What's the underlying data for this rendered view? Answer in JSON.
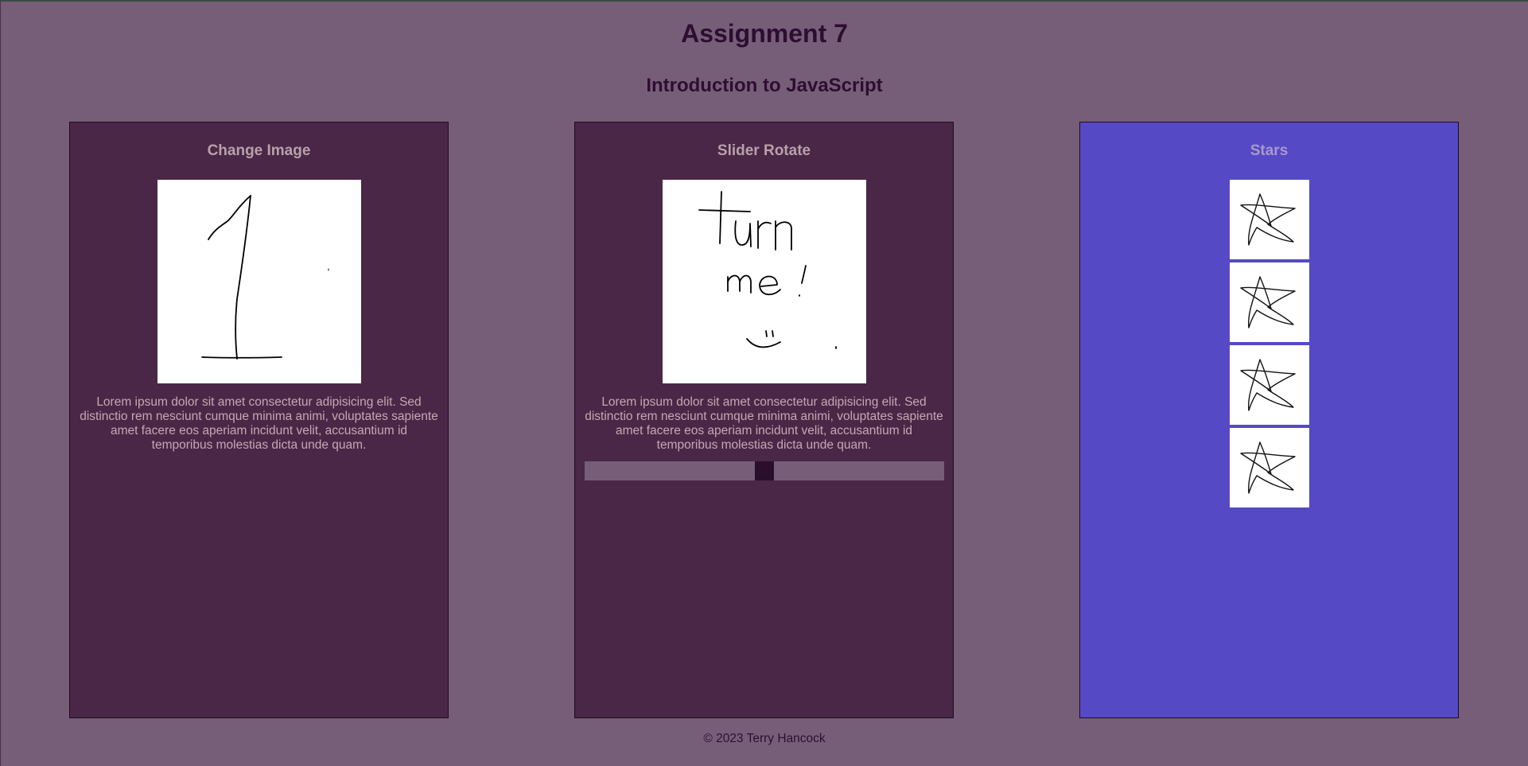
{
  "header": {
    "title": "Assignment 7",
    "subtitle": "Introduction to JavaScript"
  },
  "panels": [
    {
      "heading": "Change Image",
      "image_icon": "drawing-number-one",
      "text": "Lorem ipsum dolor sit amet consectetur adipisicing elit. Sed distinctio rem nesciunt cumque minima animi, voluptates sapiente amet facere eos aperiam incidunt velit, accusantium id temporibus molestias dicta unde quam."
    },
    {
      "heading": "Slider Rotate",
      "image_icon": "drawing-turn-me",
      "text": "Lorem ipsum dolor sit amet consectetur adipisicing elit. Sed distinctio rem nesciunt cumque minima animi, voluptates sapiente amet facere eos aperiam incidunt velit, accusantium id temporibus molestias dicta unde quam.",
      "slider_value": 0.5
    },
    {
      "heading": "Stars",
      "star_icon": "drawing-star",
      "star_count": 4
    }
  ],
  "footer": {
    "text": "© 2023 Terry Hancock"
  },
  "colors": {
    "page_background": "#765e78",
    "panel_background": "#4a2747",
    "stars_panel_background": "#5649c6",
    "heading_text": "#2e0e30",
    "panel_text": "#c5a8b3"
  }
}
